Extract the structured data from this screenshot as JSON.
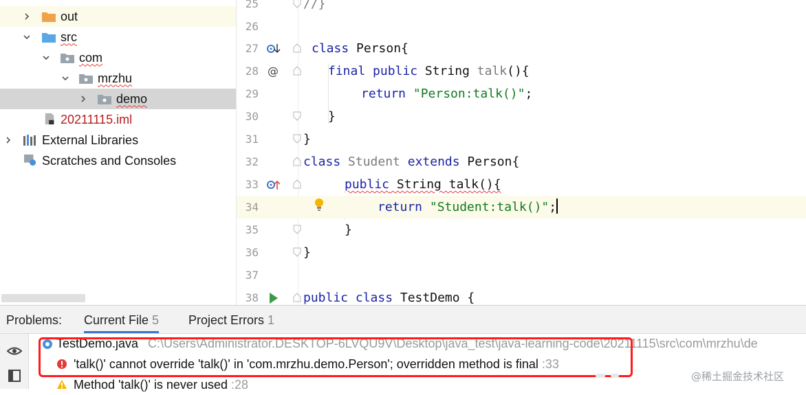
{
  "project_tree": {
    "items": [
      {
        "label": "out",
        "kind": "folder-orange",
        "expanded": false
      },
      {
        "label": "src",
        "kind": "folder-blue",
        "expanded": true
      },
      {
        "label": "com",
        "kind": "package",
        "expanded": true
      },
      {
        "label": "mrzhu",
        "kind": "package",
        "expanded": true
      },
      {
        "label": "demo",
        "kind": "package",
        "expanded": false,
        "selected": true
      },
      {
        "label": "20211115.iml",
        "kind": "iml-file"
      },
      {
        "label": "External Libraries",
        "kind": "libraries",
        "expanded": false
      },
      {
        "label": "Scratches and Consoles",
        "kind": "scratches"
      }
    ]
  },
  "editor": {
    "lines": [
      {
        "num": "25",
        "code": "//}"
      },
      {
        "num": "26",
        "code": ""
      },
      {
        "num": "27",
        "code": "class Person{"
      },
      {
        "num": "28",
        "code": "final public String talk(){"
      },
      {
        "num": "29",
        "code": "return \"Person:talk()\";"
      },
      {
        "num": "30",
        "code": "}"
      },
      {
        "num": "31",
        "code": "}"
      },
      {
        "num": "32",
        "code": "class Student extends Person{"
      },
      {
        "num": "33",
        "code": "public String talk(){"
      },
      {
        "num": "34",
        "code": "return \"Student:talk()\";"
      },
      {
        "num": "35",
        "code": "}"
      },
      {
        "num": "36",
        "code": "}"
      },
      {
        "num": "37",
        "code": ""
      },
      {
        "num": "38",
        "code": "public class TestDemo {"
      }
    ]
  },
  "problems": {
    "label": "Problems:",
    "tabs": [
      {
        "label": "Current File",
        "count": "5",
        "active": true
      },
      {
        "label": "Project Errors",
        "count": "1",
        "active": false
      }
    ],
    "file": {
      "name": "TestDemo.java",
      "path": "C:\\Users\\Administrator.DESKTOP-6LVQU9V\\Desktop\\java_test\\java-learning-code\\20211115\\src\\com\\mrzhu\\de"
    },
    "items": [
      {
        "severity": "error",
        "message": "'talk()' cannot override 'talk()' in 'com.mrzhu.demo.Person'; overridden method is final",
        "location": ":33"
      },
      {
        "severity": "warning",
        "message": "Method 'talk()' is never used",
        "location": ":28"
      }
    ]
  },
  "watermark": "@稀土掘金技术社区",
  "colors": {
    "error_box": "#ff1a1a",
    "keyword": "#1a23a5",
    "string": "#117a20",
    "active_tab": "#3d74c9"
  }
}
